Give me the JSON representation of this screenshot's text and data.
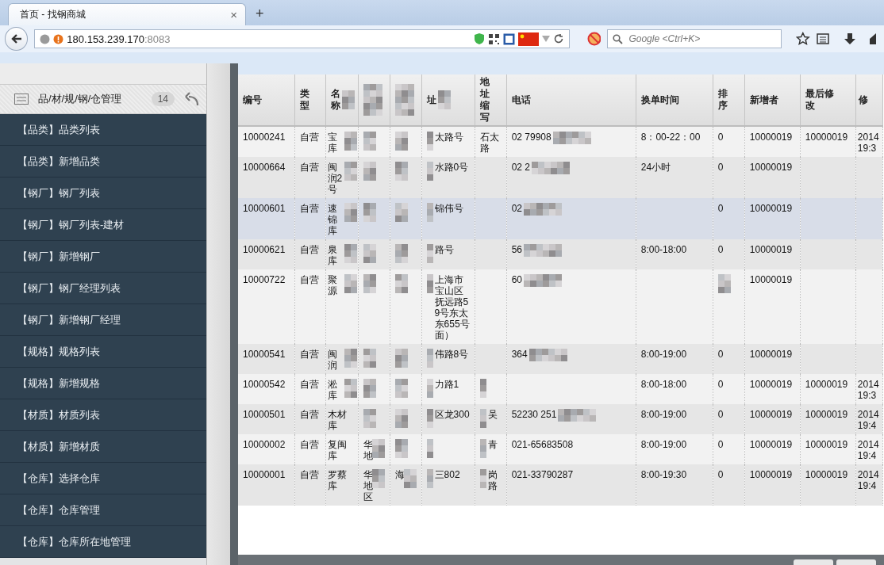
{
  "browser": {
    "tab": {
      "title": "首页 - 找钢商城",
      "close": "×"
    },
    "new_tab": "+",
    "url": {
      "host": "180.153.239.170",
      "port": ":8083"
    },
    "search": {
      "placeholder": "Google <Ctrl+K>"
    }
  },
  "sidebar": {
    "header": {
      "title": "品/材/规/钢/仓管理",
      "count": "14"
    },
    "items": [
      {
        "label": "【品类】品类列表"
      },
      {
        "label": "【品类】新增品类"
      },
      {
        "label": "【钢厂】钢厂列表"
      },
      {
        "label": "【钢厂】钢厂列表-建材"
      },
      {
        "label": "【钢厂】新增钢厂"
      },
      {
        "label": "【钢厂】钢厂经理列表"
      },
      {
        "label": "【钢厂】新增钢厂经理"
      },
      {
        "label": "【规格】规格列表"
      },
      {
        "label": "【规格】新增规格"
      },
      {
        "label": "【材质】材质列表"
      },
      {
        "label": "【材质】新增材质"
      },
      {
        "label": "【仓库】选择仓库"
      },
      {
        "label": "【仓库】仓库管理"
      },
      {
        "label": "【仓库】仓库所在地管理"
      }
    ]
  },
  "table": {
    "columns": [
      {
        "label": "编号",
        "masked": false
      },
      {
        "label": "类型",
        "masked": false
      },
      {
        "label": "名称",
        "masked": true
      },
      {
        "masked": true
      },
      {
        "masked": true
      },
      {
        "label": "址",
        "masked": true
      },
      {
        "label": "地址缩写",
        "masked": false
      },
      {
        "label": "电话",
        "masked": false
      },
      {
        "label": "换单时间",
        "masked": false
      },
      {
        "label": "排序",
        "masked": false
      },
      {
        "label": "新增者",
        "masked": false
      },
      {
        "label": "最后修改",
        "masked": false
      },
      {
        "label": "修",
        "masked": false
      }
    ],
    "rows": [
      {
        "selected": false,
        "cells": [
          {
            "text": "10000241",
            "masked": false
          },
          {
            "text": "自营",
            "masked": false
          },
          {
            "text": "宝库",
            "masked": true
          },
          {
            "masked": true
          },
          {
            "masked": true
          },
          {
            "text": "太路号",
            "masked": true
          },
          {
            "text": "石太路",
            "masked": false
          },
          {
            "text": "02 79908",
            "masked": true
          },
          {
            "text": "8：00-22：00",
            "masked": false
          },
          {
            "text": "0",
            "masked": false
          },
          {
            "text": "10000019",
            "masked": false
          },
          {
            "text": "10000019",
            "masked": false
          },
          {
            "text": "2014 19:3",
            "masked": false
          }
        ]
      },
      {
        "selected": false,
        "cells": [
          {
            "text": "10000664",
            "masked": false
          },
          {
            "text": "自营",
            "masked": false
          },
          {
            "text": "闽润2号",
            "masked": true
          },
          {
            "masked": true
          },
          {
            "masked": true
          },
          {
            "text": "水路0号",
            "masked": true
          },
          {
            "masked": false
          },
          {
            "text": "02 2",
            "masked": true
          },
          {
            "text": "24小时",
            "masked": false
          },
          {
            "text": "0",
            "masked": false
          },
          {
            "text": "10000019",
            "masked": false
          },
          {
            "masked": false
          },
          {
            "masked": false
          }
        ]
      },
      {
        "selected": true,
        "cells": [
          {
            "text": "10000601",
            "masked": false
          },
          {
            "text": "自营",
            "masked": false
          },
          {
            "text": "速锦库",
            "masked": true
          },
          {
            "masked": true
          },
          {
            "masked": true
          },
          {
            "text": "锦伟号",
            "masked": true
          },
          {
            "masked": false
          },
          {
            "text": "02",
            "masked": true
          },
          {
            "masked": false
          },
          {
            "text": "0",
            "masked": false
          },
          {
            "text": "10000019",
            "masked": false
          },
          {
            "masked": false
          },
          {
            "masked": false
          }
        ]
      },
      {
        "selected": false,
        "cells": [
          {
            "text": "10000621",
            "masked": false
          },
          {
            "text": "自营",
            "masked": false
          },
          {
            "text": "泉库",
            "masked": true
          },
          {
            "masked": true
          },
          {
            "masked": true
          },
          {
            "text": "路号",
            "masked": true
          },
          {
            "masked": false
          },
          {
            "text": "56",
            "masked": true
          },
          {
            "text": "8:00-18:00",
            "masked": false
          },
          {
            "text": "0",
            "masked": false
          },
          {
            "text": "10000019",
            "masked": false
          },
          {
            "masked": false
          },
          {
            "masked": false
          }
        ]
      },
      {
        "selected": false,
        "cells": [
          {
            "text": "10000722",
            "masked": false
          },
          {
            "text": "自营",
            "masked": false
          },
          {
            "text": "聚源",
            "masked": true
          },
          {
            "masked": true
          },
          {
            "masked": true
          },
          {
            "text": "上海市宝山区抚远路59号东太东655号面）",
            "masked": true
          },
          {
            "masked": false
          },
          {
            "text": "60",
            "masked": true
          },
          {
            "masked": false
          },
          {
            "masked": true
          },
          {
            "text": "10000019",
            "masked": false
          },
          {
            "masked": false
          },
          {
            "masked": false
          }
        ]
      },
      {
        "selected": false,
        "cells": [
          {
            "text": "10000541",
            "masked": false
          },
          {
            "text": "自营",
            "masked": false
          },
          {
            "text": "闽润",
            "masked": true
          },
          {
            "masked": true
          },
          {
            "masked": true
          },
          {
            "text": "伟路8号",
            "masked": true
          },
          {
            "masked": false
          },
          {
            "text": "364",
            "masked": true
          },
          {
            "text": "8:00-19:00",
            "masked": false
          },
          {
            "text": "0",
            "masked": false
          },
          {
            "text": "10000019",
            "masked": false
          },
          {
            "masked": false
          },
          {
            "masked": false
          }
        ]
      },
      {
        "selected": false,
        "cells": [
          {
            "text": "10000542",
            "masked": false
          },
          {
            "text": "自营",
            "masked": false
          },
          {
            "text": "淞库",
            "masked": true
          },
          {
            "masked": true
          },
          {
            "masked": true
          },
          {
            "text": "力路1",
            "masked": true
          },
          {
            "masked": true
          },
          {
            "masked": false
          },
          {
            "text": "8:00-18:00",
            "masked": false
          },
          {
            "text": "0",
            "masked": false
          },
          {
            "text": "10000019",
            "masked": false
          },
          {
            "text": "10000019",
            "masked": false
          },
          {
            "text": "2014 19:3",
            "masked": false
          }
        ]
      },
      {
        "selected": false,
        "cells": [
          {
            "text": "10000501",
            "masked": false
          },
          {
            "text": "自营",
            "masked": false
          },
          {
            "text": "木材库",
            "masked": false
          },
          {
            "masked": true
          },
          {
            "masked": true
          },
          {
            "text": "区龙300",
            "masked": true
          },
          {
            "text": "吴",
            "masked": true
          },
          {
            "text": "52230 251",
            "masked": true
          },
          {
            "text": "8:00-19:00",
            "masked": false
          },
          {
            "text": "0",
            "masked": false
          },
          {
            "text": "10000019",
            "masked": false
          },
          {
            "text": "10000019",
            "masked": false
          },
          {
            "text": "2014 19:4",
            "masked": false
          }
        ]
      },
      {
        "selected": false,
        "cells": [
          {
            "text": "10000002",
            "masked": false
          },
          {
            "text": "自营",
            "masked": false
          },
          {
            "text": "复闽库",
            "masked": false
          },
          {
            "text": "华地",
            "masked": true
          },
          {
            "masked": true
          },
          {
            "masked": true
          },
          {
            "text": "青",
            "masked": true
          },
          {
            "text": "021-65683508",
            "masked": false
          },
          {
            "text": "8:00-19:00",
            "masked": false
          },
          {
            "text": "0",
            "masked": false
          },
          {
            "text": "10000019",
            "masked": false
          },
          {
            "text": "10000019",
            "masked": false
          },
          {
            "text": "2014 19:4",
            "masked": false
          }
        ]
      },
      {
        "selected": false,
        "cells": [
          {
            "text": "10000001",
            "masked": false
          },
          {
            "text": "自营",
            "masked": false
          },
          {
            "text": "罗蔡库",
            "masked": false
          },
          {
            "text": "华地区",
            "masked": true
          },
          {
            "text": "海",
            "masked": true
          },
          {
            "text": "三802",
            "masked": true
          },
          {
            "text": "岗路",
            "masked": true
          },
          {
            "text": "021-33790287",
            "masked": false
          },
          {
            "text": "8:00-19:30",
            "masked": false
          },
          {
            "text": "0",
            "masked": false
          },
          {
            "text": "10000019",
            "masked": false
          },
          {
            "text": "10000019",
            "masked": false
          },
          {
            "text": "2014 19:4",
            "masked": false
          }
        ]
      }
    ]
  }
}
